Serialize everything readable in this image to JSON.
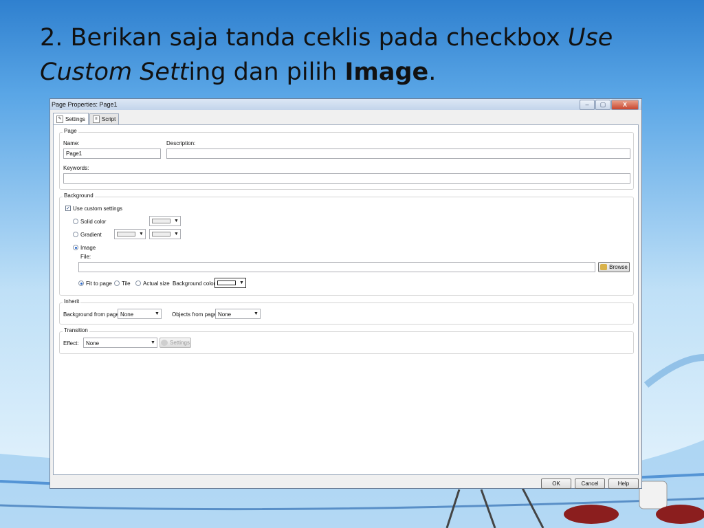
{
  "slide": {
    "title_num": "2. Berikan saja tanda ceklis pada checkbox ",
    "title_use": "Use",
    "title_custom": "Custom Sett",
    "title_ing": "ing dan pilih ",
    "title_image": "Image",
    "title_dot": "."
  },
  "dialog": {
    "title": "Page Properties: Page1",
    "tabs": [
      {
        "label": "Settings",
        "icon": "pencil-icon"
      },
      {
        "label": "Script",
        "icon": "script-icon"
      }
    ],
    "page": {
      "group_label": "Page",
      "name_label": "Name:",
      "name_value": "Page1",
      "description_label": "Description:",
      "description_value": "",
      "keywords_label": "Keywords:",
      "keywords_value": ""
    },
    "background": {
      "group_label": "Background",
      "use_custom_label": "Use custom settings",
      "use_custom_checked": true,
      "solid_color_label": "Solid color",
      "gradient_label": "Gradient",
      "image_label": "Image",
      "selected_mode": "Image",
      "file_label": "File:",
      "file_value": "",
      "browse_label": "Browse",
      "fit_to_page_label": "Fit to page",
      "tile_label": "Tile",
      "actual_size_label": "Actual size",
      "selected_sizing": "Fit to page",
      "bg_color_label": "Background color:",
      "bg_color_value": "#ffffff"
    },
    "inherit": {
      "group_label": "Inherit",
      "bg_from_page_label": "Background from page:",
      "bg_from_page_value": "None",
      "objects_from_page_label": "Objects from page:",
      "objects_from_page_value": "None"
    },
    "transition": {
      "group_label": "Transition",
      "effect_label": "Effect:",
      "effect_value": "None",
      "settings_label": "Settings"
    },
    "footer": {
      "ok_label": "OK",
      "cancel_label": "Cancel",
      "help_label": "Help"
    },
    "window_buttons": {
      "minimize": "–",
      "maximize": "▢",
      "close": "X"
    }
  },
  "colors": {
    "accent": "#2464c8",
    "titlebar": "#c3d4ea",
    "close_button": "#c9452e"
  }
}
